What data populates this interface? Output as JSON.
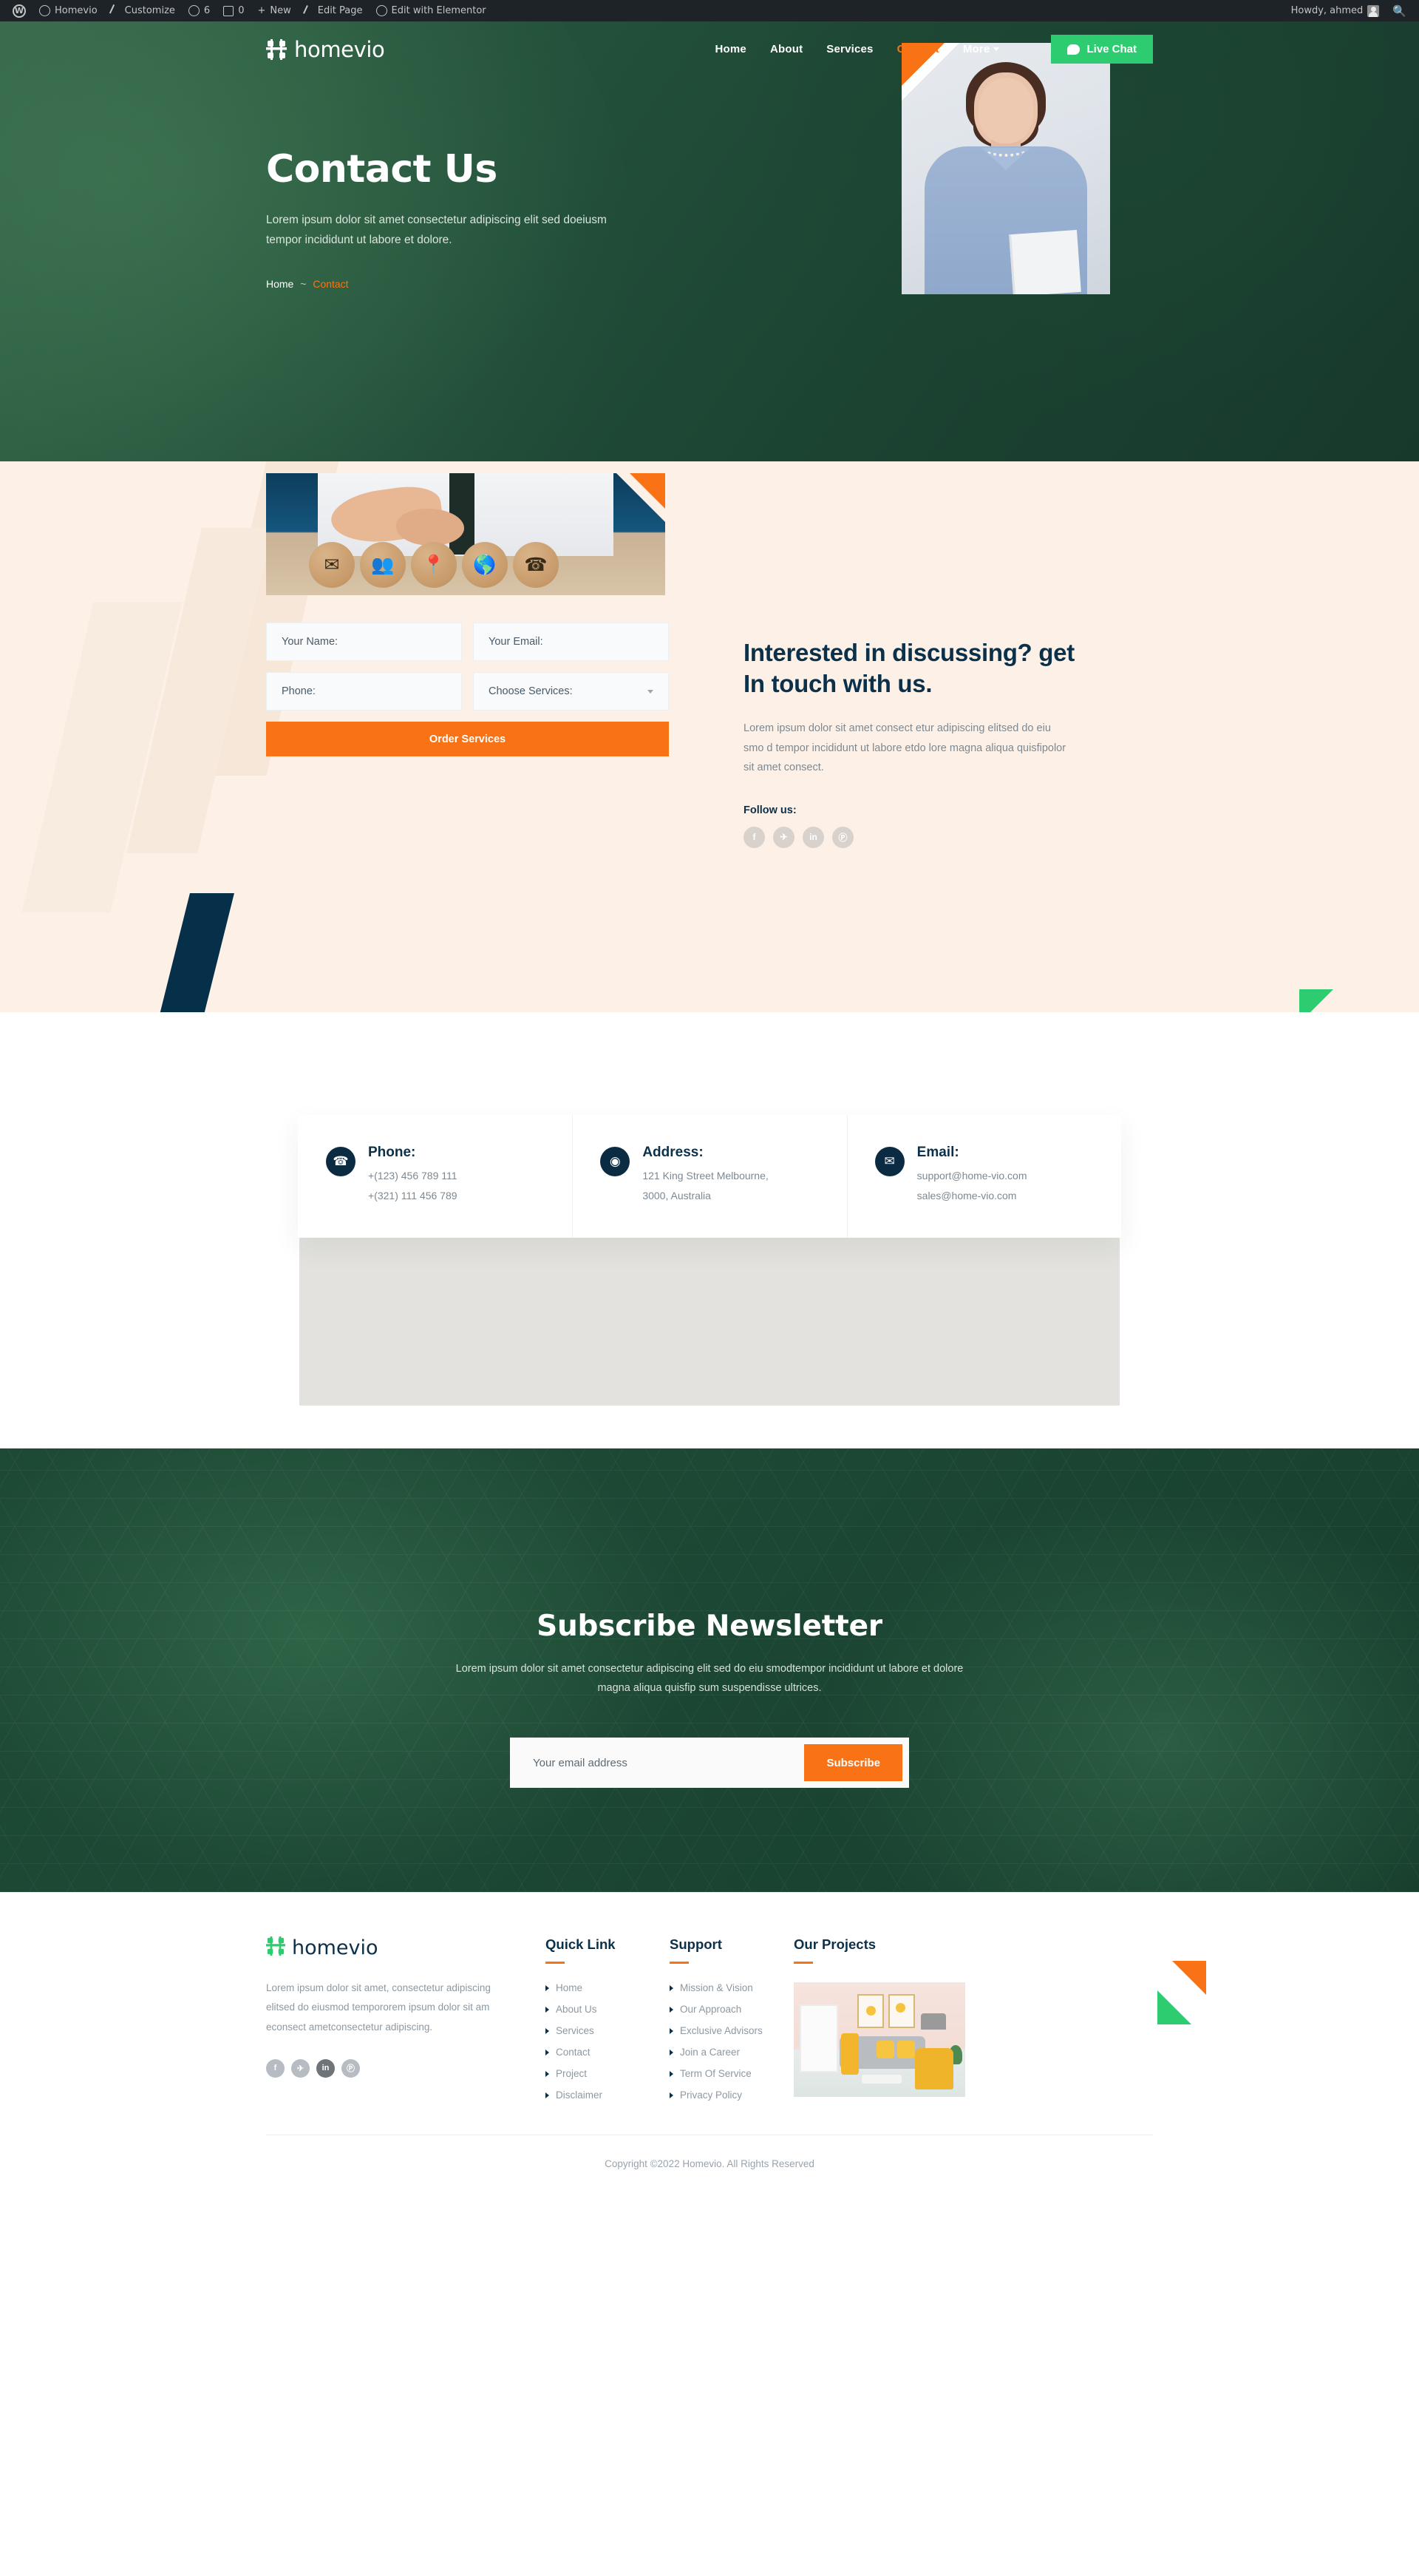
{
  "adminbar": {
    "wp_logo": "wordpress-logo",
    "site_name": "Homevio",
    "customize": "Customize",
    "updates_count": "6",
    "comments_count": "0",
    "new": "New",
    "edit_page": "Edit Page",
    "edit_elementor": "Edit with Elementor",
    "howdy": "Howdy, ahmed"
  },
  "header": {
    "brand": "homevio",
    "nav": [
      {
        "label": "Home",
        "active": false
      },
      {
        "label": "About",
        "active": false
      },
      {
        "label": "Services",
        "active": false
      },
      {
        "label": "Contact",
        "active": true
      },
      {
        "label": "More",
        "active": false
      }
    ],
    "live_chat": "Live Chat"
  },
  "hero": {
    "title": "Contact Us",
    "subtitle": "Lorem ipsum dolor sit amet consectetur adipiscing elit sed doeiusm tempor incididunt ut labore et dolore.",
    "breadcrumb_home": "Home",
    "breadcrumb_sep": "~",
    "breadcrumb_current": "Contact"
  },
  "form": {
    "fields": [
      {
        "placeholder": "Your Name:"
      },
      {
        "placeholder": "Your Email:"
      },
      {
        "placeholder": "Phone:"
      },
      {
        "placeholder": "Choose Services:"
      }
    ],
    "submit": "Order Services",
    "image_icons": [
      "envelope",
      "people",
      "location-pin",
      "globe",
      "phone"
    ]
  },
  "intro": {
    "title": "Interested in discussing? get In touch with us.",
    "paragraph": "Lorem ipsum dolor sit amet consect etur adipiscing elitsed do eiu smo d tempor incididunt ut labore etdo lore magna aliqua quisfipolor sit amet consect.",
    "follow_label": "Follow us:",
    "socials": [
      {
        "name": "facebook",
        "glyph": "f"
      },
      {
        "name": "twitter",
        "glyph": "✈"
      },
      {
        "name": "linkedin",
        "glyph": "in"
      },
      {
        "name": "pinterest",
        "glyph": "Ⓟ"
      }
    ]
  },
  "cards": [
    {
      "icon": "phone-icon",
      "glyph": "☎",
      "heading": "Phone:",
      "line1": "+(123) 456 789 111",
      "line2": "+(321) 111 456 789"
    },
    {
      "icon": "map-marker-icon",
      "glyph": "◉",
      "heading": "Address:",
      "line1": "121 King Street Melbourne,",
      "line2": "3000, Australia"
    },
    {
      "icon": "email-icon",
      "glyph": "✉",
      "heading": "Email:",
      "line1": "support@home-vio.com",
      "line2": "sales@home-vio.com"
    }
  ],
  "newsletter": {
    "title": "Subscribe Newsletter",
    "paragraph": "Lorem ipsum dolor sit amet consectetur adipiscing elit sed do eiu smodtempor incididunt ut labore et dolore magna aliqua quisfip sum suspendisse ultrices.",
    "input_placeholder": "Your email address",
    "button": "Subscribe"
  },
  "footer": {
    "brand": "homevio",
    "description": "Lorem ipsum dolor sit amet, consectetur adipiscing elitsed do eiusmod tempororem ipsum dolor sit am econsect ametconsectetur adipiscing.",
    "socials": [
      {
        "name": "facebook",
        "glyph": "f"
      },
      {
        "name": "twitter",
        "glyph": "✈"
      },
      {
        "name": "linkedin",
        "glyph": "in"
      },
      {
        "name": "pinterest",
        "glyph": "Ⓟ"
      }
    ],
    "columns": [
      {
        "heading": "Quick Link",
        "items": [
          "Home",
          "About Us",
          "Services",
          "Contact",
          "Project",
          "Disclaimer"
        ]
      },
      {
        "heading": "Support",
        "items": [
          "Mission & Vision",
          "Our Approach",
          "Exclusive Advisors",
          "Join a Career",
          "Term Of Service",
          "Privacy Policy"
        ]
      }
    ],
    "projects_heading": "Our Projects",
    "copyright": "Copyright ©2022 Homevio. All Rights Reserved"
  },
  "colors": {
    "accent_orange": "#f97316",
    "accent_green": "#2ecc71",
    "dark_navy": "#0b3049",
    "hero_green": "#1d4a35",
    "cream": "#fdf1e7"
  }
}
